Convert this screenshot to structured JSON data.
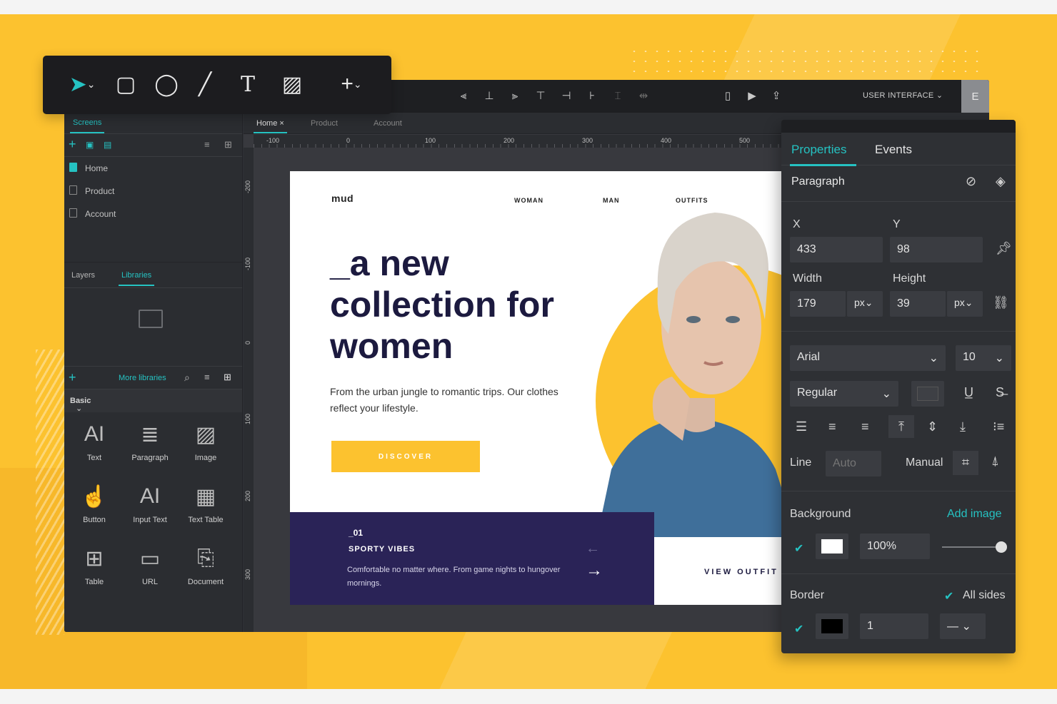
{
  "topbar": {
    "ui_select": "USER INTERFACE",
    "avatar": "E",
    "align_icons": [
      "align-left-icon",
      "align-center-icon",
      "align-right-icon",
      "align-top-icon",
      "align-middle-icon",
      "align-bottom-icon",
      "distribute-v-icon",
      "distribute-h-icon"
    ],
    "preview_icons": [
      "mobile-icon",
      "play-icon",
      "share-icon"
    ]
  },
  "left": {
    "tabs": {
      "screens": "Screens",
      "layers": "Layers",
      "libraries": "Libraries"
    },
    "screens": [
      {
        "label": "Home",
        "selected": true
      },
      {
        "label": "Product",
        "selected": false
      },
      {
        "label": "Account",
        "selected": false
      }
    ],
    "more_libraries": "More libraries",
    "basic": "Basic",
    "widgets": [
      {
        "label": "Text",
        "glyph": "AI"
      },
      {
        "label": "Paragraph",
        "glyph": "≣"
      },
      {
        "label": "Image",
        "glyph": "▨"
      },
      {
        "label": "Button",
        "glyph": "☝"
      },
      {
        "label": "Input Text",
        "glyph": "AI"
      },
      {
        "label": "Text Table",
        "glyph": "▦"
      },
      {
        "label": "Table",
        "glyph": "⊞"
      },
      {
        "label": "URL",
        "glyph": "▭"
      },
      {
        "label": "Document",
        "glyph": "⎘"
      }
    ]
  },
  "canvas": {
    "tabs": [
      {
        "label": "Home",
        "active": true
      },
      {
        "label": "Product",
        "active": false
      },
      {
        "label": "Account",
        "active": false
      }
    ],
    "hruler": [
      "-100",
      "0",
      "100",
      "200",
      "300",
      "400",
      "500"
    ],
    "vruler": [
      "-200",
      "-100",
      "0",
      "100",
      "200",
      "300"
    ]
  },
  "artboard": {
    "logo": "mud",
    "nav": [
      "WOMAN",
      "MAN",
      "OUTFITS"
    ],
    "headline": "_a new collection for women",
    "sub": "From the urban jungle to romantic trips. Our clothes reflect your lifestyle.",
    "button": "DISCOVER",
    "band": {
      "num": "_01",
      "title": "SPORTY VIBES",
      "desc": "Comfortable no matter where. From game nights to hungover mornings."
    },
    "view": "VIEW OUTFIT"
  },
  "drawbar": {
    "tools": [
      "pointer-icon",
      "rectangle-icon",
      "ellipse-icon",
      "line-icon",
      "text-icon",
      "image-icon",
      "add-icon"
    ]
  },
  "props": {
    "tabs": {
      "properties": "Properties",
      "events": "Events"
    },
    "element": "Paragraph",
    "x_label": "X",
    "y_label": "Y",
    "x": "433",
    "y": "98",
    "width_label": "Width",
    "height_label": "Height",
    "width": "179",
    "height": "39",
    "unit": "px",
    "font": "Arial",
    "size": "10",
    "weight": "Regular",
    "line_label": "Line",
    "line_placeholder": "Auto",
    "manual": "Manual",
    "background_label": "Background",
    "add_image": "Add image",
    "opacity": "100%",
    "border_label": "Border",
    "all_sides": "All sides",
    "border_width": "1",
    "colors": {
      "accent": "#25c2c2",
      "bg_swatch": "#ffffff",
      "border_swatch": "#000000"
    }
  }
}
